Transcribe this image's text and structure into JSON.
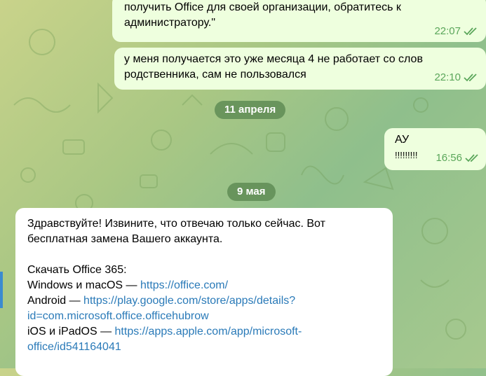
{
  "messages": {
    "msg1": {
      "line1": "получить Office для своей организации, обратитесь к",
      "line2": "администратору.\"",
      "time": "22:07"
    },
    "msg2": {
      "line1": "у меня получается это уже месяца 4 не работает со слов",
      "line2": "родственника, сам не пользовался",
      "time": "22:10"
    },
    "date1": "11 апреля",
    "msg3": {
      "line1": "АУ",
      "line2": "!!!!!!!!!",
      "time": "16:56"
    },
    "date2": "9 мая",
    "msg4": {
      "p1_line1": "Здравствуйте! Извините, что отвечаю только сейчас. Вот",
      "p1_line2": "бесплатная замена Вашего аккаунта.",
      "heading": "Скачать Office 365:",
      "win_label": "Windows и macOS — ",
      "win_link": "https://office.com/",
      "android_label": "Android — ",
      "android_link1": "https://play.google.com/store/apps/details?",
      "android_link2": "id=com.microsoft.office.officehubrow",
      "ios_label": "iOS и iPadOS — ",
      "ios_link1": "https://apps.apple.com/app/microsoft-",
      "ios_link2": "office/id541164041"
    }
  },
  "colors": {
    "outgoing_bubble": "#eeffde",
    "incoming_bubble": "#ffffff",
    "time_green": "#5aa65a",
    "link": "#2a7ab8",
    "date_pill": "#5f8c55"
  },
  "icons": {
    "read_ticks": "double-check-icon"
  }
}
